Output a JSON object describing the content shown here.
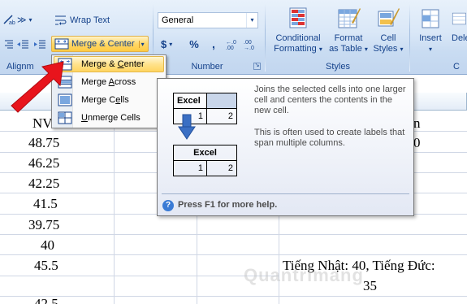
{
  "ribbon": {
    "alignment_group": "Alignm",
    "wrap_text": "Wrap Text",
    "merge_center": "Merge & Center",
    "number_group": "Number",
    "number_format": "General",
    "currency": "$",
    "percent": "%",
    "comma": ",",
    "styles_group": "Styles",
    "conditional_formatting": [
      "Conditional",
      "Formatting"
    ],
    "format_as_table": [
      "Format",
      "as Table"
    ],
    "cell_styles": [
      "Cell",
      "Styles"
    ],
    "insert": "Insert",
    "dele": "Dele",
    "cells_group": "C"
  },
  "menu": {
    "items": [
      {
        "pre": "Merge & ",
        "key": "C",
        "post": "enter"
      },
      {
        "pre": "Merge ",
        "key": "A",
        "post": "cross"
      },
      {
        "pre": "Merge C",
        "key": "e",
        "post": "lls"
      },
      {
        "pre": "",
        "key": "U",
        "post": "nmerge Cells"
      }
    ]
  },
  "tooltip": {
    "description": "Joins the selected cells into one larger cell and centers the contents in the new cell.",
    "note": "This is often used to create labels that span multiple columns.",
    "help": "Press F1 for more help.",
    "demo_text": "Excel",
    "demo_num1": "1",
    "demo_num2": "2"
  },
  "sheet": {
    "col_c": "C",
    "cells": [
      "NV",
      "48.75",
      "46.25",
      "42.25",
      "41.5",
      "39.75",
      "40",
      "45.5",
      "42.5"
    ],
    "right_top": "n",
    "right_val": "0",
    "note_line1": "Tiếng Nhật: 40, Tiếng Đức:",
    "note_line2": "35"
  },
  "watermark": "Quantrimang"
}
